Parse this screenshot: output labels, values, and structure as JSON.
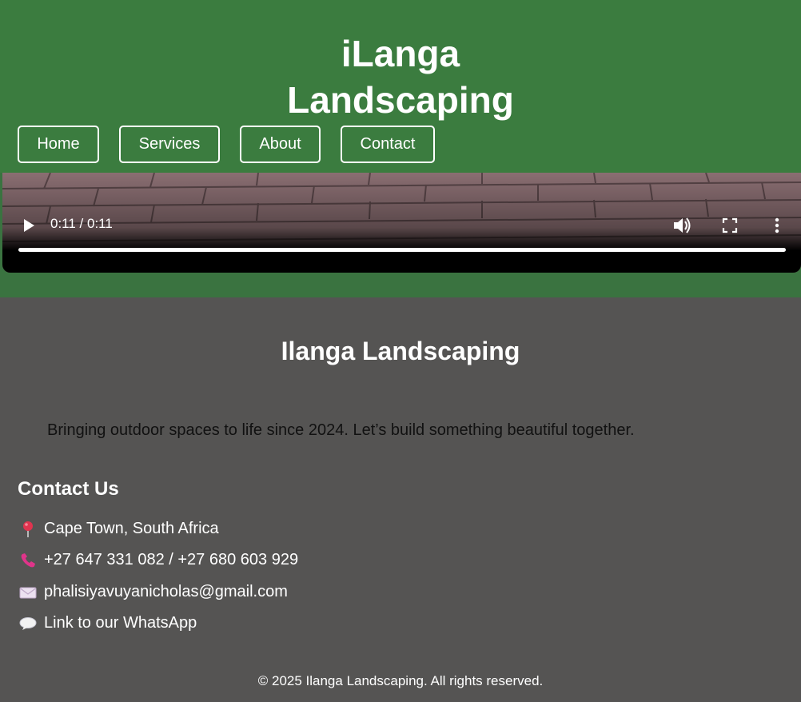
{
  "header": {
    "title_line1": "iLanga",
    "title_line2": "Landscaping"
  },
  "nav": {
    "home": "Home",
    "services": "Services",
    "about": "About",
    "contact": "Contact"
  },
  "video": {
    "time": "0:11 / 0:11",
    "progress": 1.0
  },
  "footer": {
    "title": "Ilanga Landscaping",
    "tagline": "Bringing outdoor spaces to life since 2024. Let’s build something beautiful together.",
    "contact_heading": "Contact Us",
    "location": "Cape Town, South Africa",
    "phone": "+27 647 331 082 / +27 680 603 929",
    "email": "phalisiyavuyanicholas@gmail.com",
    "whatsapp": "Link to our WhatsApp",
    "copyright": "© 2025 Ilanga Landscaping. All rights reserved."
  },
  "icons": {
    "location": "round-pushpin-icon",
    "phone": "telephone-receiver-icon",
    "email": "envelope-icon",
    "whatsapp": "speech-bubble-icon"
  },
  "colors": {
    "header_green": "#3b7c3f",
    "footer_gray": "#555453"
  }
}
